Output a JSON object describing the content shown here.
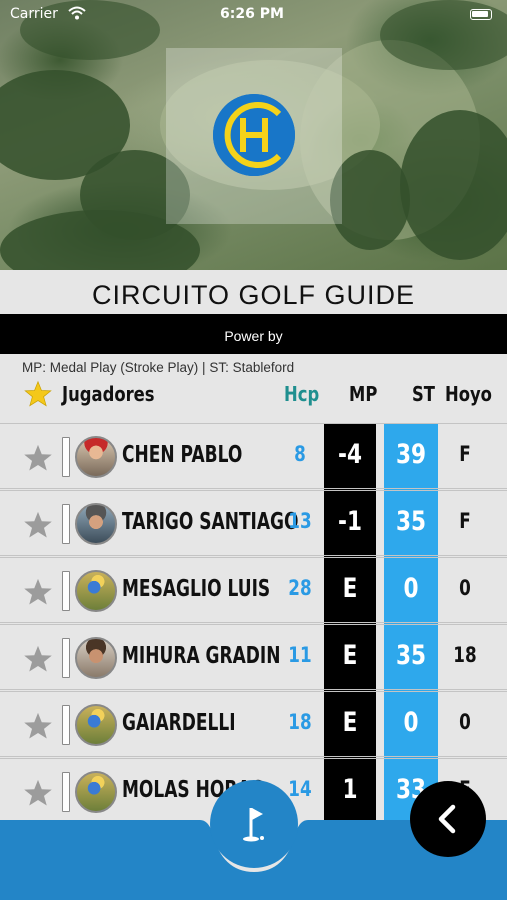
{
  "status_bar": {
    "carrier": "Carrier",
    "time": "6:26 PM"
  },
  "title": "CIRCUITO GOLF GUIDE",
  "power_by": "Power by",
  "legend": "MP: Medal Play (Stroke Play) | ST: Stableford",
  "table": {
    "headers": {
      "players": "Jugadores",
      "hcp": "Hcp",
      "mp": "MP",
      "st": "ST",
      "hoyo": "Hoyo"
    },
    "rows": [
      {
        "name": "CHEN PABLO",
        "hcp": "8",
        "mp": "-4",
        "st": "39",
        "hoyo": "F"
      },
      {
        "name": "TARIGO SANTIAGO",
        "hcp": "13",
        "mp": "-1",
        "st": "35",
        "hoyo": "F"
      },
      {
        "name": "MESAGLIO LUIS",
        "hcp": "28",
        "mp": "E",
        "st": "0",
        "hoyo": "0"
      },
      {
        "name": "MIHURA GRADIN",
        "hcp": "11",
        "mp": "E",
        "st": "35",
        "hoyo": "18"
      },
      {
        "name": "GAIARDELLI",
        "hcp": "18",
        "mp": "E",
        "st": "0",
        "hoyo": "0"
      },
      {
        "name": "MOLAS HORAC",
        "hcp": "14",
        "mp": "1",
        "st": "33",
        "hoyo": "F"
      }
    ]
  },
  "icons": {
    "logo": "club-logo-icon",
    "favorite": "star-icon",
    "golf": "golf-flag-icon",
    "back": "chevron-left-icon"
  },
  "colors": {
    "accent_blue": "#2ea8ec",
    "hcp_blue": "#2a9ae4",
    "header_teal": "#1f8f8f",
    "fab_blue": "#2385c7",
    "logo_yellow": "#f4d21a"
  }
}
